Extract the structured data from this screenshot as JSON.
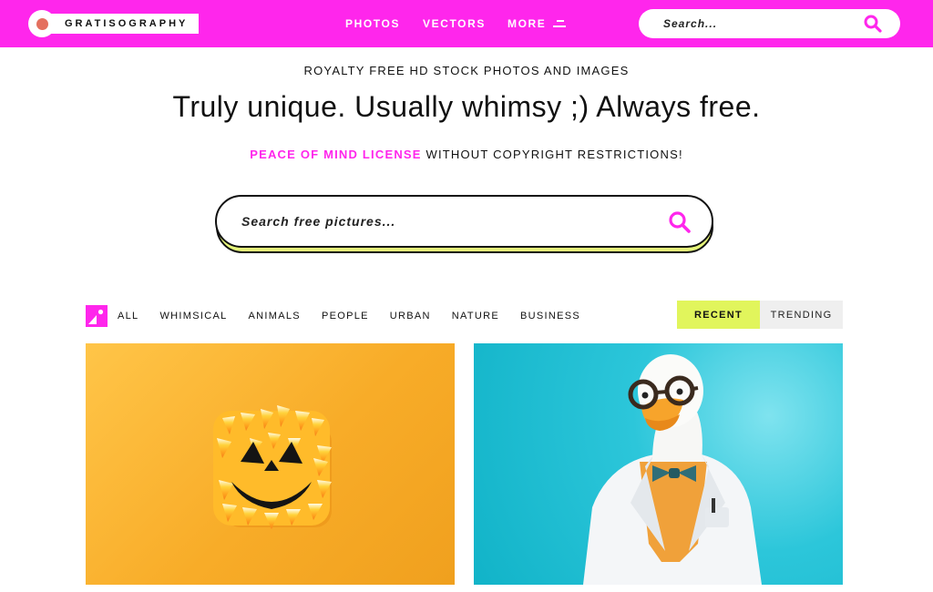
{
  "header": {
    "logo_text": "GRATISOGRAPHY",
    "nav": [
      "PHOTOS",
      "VECTORS",
      "MORE"
    ],
    "search_placeholder": "Search..."
  },
  "hero": {
    "tagline": "ROYALTY FREE HD STOCK PHOTOS AND IMAGES",
    "headline": "Truly unique. Usually whimsy ;) Always free.",
    "license_link": "PEACE OF MIND LICENSE",
    "license_rest": " WITHOUT COPYRIGHT RESTRICTIONS!",
    "search_placeholder": "Search free pictures..."
  },
  "categories": [
    "ALL",
    "WHIMSICAL",
    "ANIMALS",
    "PEOPLE",
    "URBAN",
    "NATURE",
    "BUSINESS"
  ],
  "sort": {
    "recent": "RECENT",
    "trending": "TRENDING"
  },
  "colors": {
    "brand_pink": "#ff26ec",
    "accent_lime": "#e1f55c",
    "logo_dot": "#e4705f"
  },
  "photos": [
    {
      "subject": "candy-corn-jack-o-lantern"
    },
    {
      "subject": "duck-in-lab-coat-with-glasses"
    }
  ]
}
